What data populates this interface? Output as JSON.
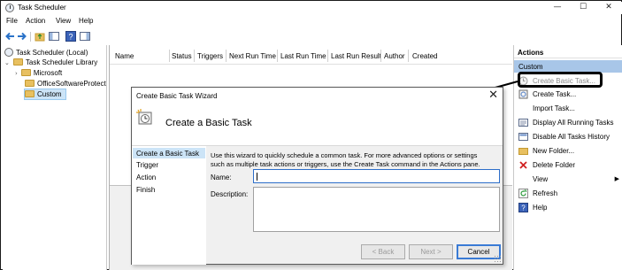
{
  "window": {
    "title": "Task Scheduler",
    "minimize": "—",
    "maximize": "☐",
    "close": "✕"
  },
  "menu": {
    "file": "File",
    "action": "Action",
    "view": "View",
    "help": "Help"
  },
  "tree": {
    "root": "Task Scheduler (Local)",
    "library": "Task Scheduler Library",
    "microsoft": "Microsoft",
    "office": "OfficeSoftwareProtect",
    "custom": "Custom"
  },
  "columns": [
    "Name",
    "Status",
    "Triggers",
    "Next Run Time",
    "Last Run Time",
    "Last Run Result",
    "Author",
    "Created"
  ],
  "actions": {
    "header": "Actions",
    "section": "Custom",
    "items": [
      {
        "label": "Create Basic Task...",
        "icon": "basic-task-icon",
        "disabled": true
      },
      {
        "label": "Create Task...",
        "icon": "task-icon"
      },
      {
        "label": "Import Task...",
        "icon": ""
      },
      {
        "label": "Display All Running Tasks",
        "icon": "running-tasks-icon"
      },
      {
        "label": "Disable All Tasks History",
        "icon": "history-icon"
      },
      {
        "label": "New Folder...",
        "icon": "folder-icon"
      },
      {
        "label": "Delete Folder",
        "icon": "delete-icon"
      },
      {
        "label": "View",
        "icon": "",
        "submenu": true
      },
      {
        "label": "Refresh",
        "icon": "refresh-icon"
      },
      {
        "label": "Help",
        "icon": "help-icon"
      }
    ]
  },
  "dialog": {
    "title": "Create Basic Task Wizard",
    "heading": "Create a Basic Task",
    "close": "✕",
    "steps": [
      "Create a Basic Task",
      "Trigger",
      "Action",
      "Finish"
    ],
    "description_line1": "Use this wizard to quickly schedule a common task.  For more advanced options or settings",
    "description_line2": "such as multiple task actions or triggers, use the Create Task command in the Actions pane.",
    "name_label": "Name:",
    "name_value": "",
    "description_label": "Description:",
    "back": "< Back",
    "next": "Next >",
    "cancel": "Cancel"
  },
  "colors": {
    "accent": "#2d6ec9",
    "selection": "#cce4f7",
    "section": "#a8c6e8",
    "folder": "#e8c060"
  }
}
